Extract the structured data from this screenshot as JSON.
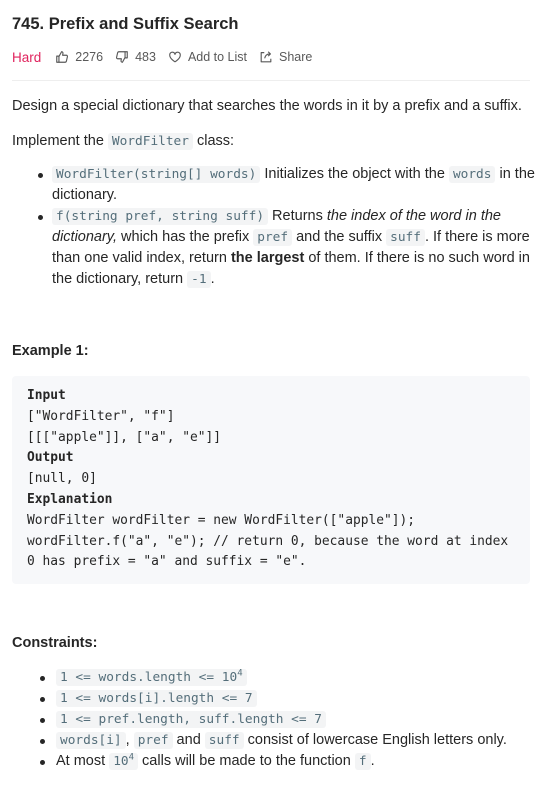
{
  "problem": {
    "title": "745. Prefix and Suffix Search",
    "difficulty": "Hard",
    "likes": "2276",
    "dislikes": "483",
    "add_to_list": "Add to List",
    "share": "Share"
  },
  "description": {
    "intro": "Design a special dictionary that searches the words in it by a prefix and a suffix.",
    "implement_prefix": "Implement the ",
    "implement_class": "WordFilter",
    "implement_suffix": " class:",
    "bullet1": {
      "code": "WordFilter(string[] words)",
      "text1": " Initializes the object with the ",
      "code2": "words",
      "text2": " in the dictionary."
    },
    "bullet2": {
      "code": "f(string pref, string suff)",
      "text1": " Returns ",
      "em": "the index of the word in the dictionary,",
      "text2": " which has the prefix ",
      "code2": "pref",
      "text3": " and the suffix ",
      "code3": "suff",
      "text4": ". If there is more than one valid index, return ",
      "strong": "the largest",
      "text5": " of them. If there is no such word in the dictionary, return ",
      "code4": "-1",
      "text6": "."
    }
  },
  "example": {
    "title": "Example 1:",
    "input_label": "Input",
    "input_line1": "[\"WordFilter\", \"f\"]",
    "input_line2": "[[[\"apple\"]], [\"a\", \"e\"]]",
    "output_label": "Output",
    "output_line": "[null, 0]",
    "explanation_label": "Explanation",
    "expl_line1": "WordFilter wordFilter = new WordFilter([\"apple\"]);",
    "expl_line2": "wordFilter.f(\"a\", \"e\"); // return 0, because the word at index",
    "expl_line3": "0 has prefix = \"a\" and suffix = \"e\"."
  },
  "constraints": {
    "title": "Constraints:",
    "c1_code": "1 <= words.length <= 10",
    "c1_sup": "4",
    "c2_code": "1 <= words[i].length <= 7",
    "c3_code": "1 <= pref.length, suff.length <= 7",
    "c4_code1": "words[i]",
    "c4_sep1": ", ",
    "c4_code2": "pref",
    "c4_sep2": " and ",
    "c4_code3": "suff",
    "c4_text": " consist of lowercase English letters only.",
    "c5_text1": "At most ",
    "c5_code": "10",
    "c5_sup": "4",
    "c5_text2": " calls will be made to the function ",
    "c5_code2": "f",
    "c5_text3": "."
  }
}
